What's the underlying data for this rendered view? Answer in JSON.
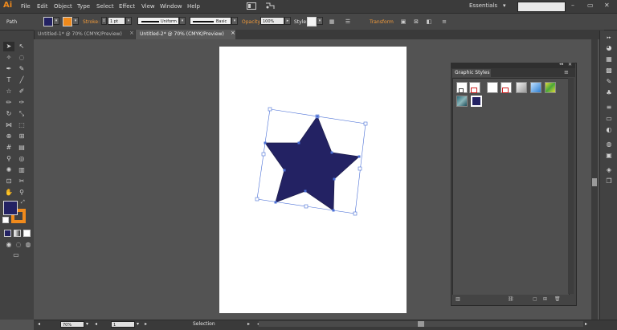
{
  "app": {
    "logo": "Ai"
  },
  "menu": [
    "File",
    "Edit",
    "Object",
    "Type",
    "Select",
    "Effect",
    "View",
    "Window",
    "Help"
  ],
  "workspace": "Essentials",
  "window_controls": [
    "–",
    "▭",
    "✕"
  ],
  "control_bar": {
    "selection_label": "Path",
    "fill_color": "#232263",
    "stroke_color": "#f08a1c",
    "stroke_label": "Stroke:",
    "stroke_weight": "1 pt",
    "profile": "Uniform",
    "brush": "Basic",
    "opacity_label": "Opacity:",
    "opacity_value": "100%",
    "style_label": "Style:",
    "transform_label": "Transform"
  },
  "tabs": [
    {
      "label": "Untitled-1* @ 70% (CMYK/Preview)",
      "close": "×",
      "active": false
    },
    {
      "label": "Untitled-2* @ 70% (CMYK/Preview)",
      "close": "×",
      "active": true
    }
  ],
  "tools_panel": {
    "fill_color": "#232263",
    "stroke_color": "#f08a1c"
  },
  "star": {
    "fill": "#232263",
    "stroke": "#1e1e4e"
  },
  "graphic_styles_panel": {
    "title": "Graphic Styles",
    "swatches": [
      "default-white",
      "none-style",
      "white-style",
      "none-style-2",
      "gray-gradient",
      "blue-gradient",
      "yellow-green-texture",
      "teal-texture",
      "navy-solid"
    ],
    "panel_controls": [
      "◂◂",
      "✕"
    ]
  },
  "status_bar": {
    "zoom": "70%",
    "page": "1",
    "tool": "Selection"
  }
}
